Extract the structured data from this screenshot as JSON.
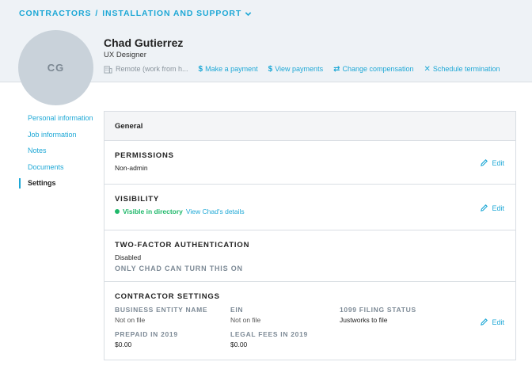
{
  "breadcrumb": {
    "section": "CONTRACTORS",
    "separator": "/",
    "team": "INSTALLATION AND SUPPORT"
  },
  "profile": {
    "initials": "CG",
    "name": "Chad Gutierrez",
    "role": "UX Designer",
    "location": "Remote (work from h..."
  },
  "actions": {
    "make_payment": "Make a payment",
    "view_payments": "View payments",
    "change_compensation": "Change compensation",
    "schedule_termination": "Schedule termination"
  },
  "sidebar": {
    "items": [
      {
        "label": "Personal information",
        "active": false
      },
      {
        "label": "Job information",
        "active": false
      },
      {
        "label": "Notes",
        "active": false
      },
      {
        "label": "Documents",
        "active": false
      },
      {
        "label": "Settings",
        "active": true
      }
    ]
  },
  "card": {
    "title": "General",
    "edit_label": "Edit",
    "permissions": {
      "title": "PERMISSIONS",
      "value": "Non-admin"
    },
    "visibility": {
      "title": "VISIBILITY",
      "status": "Visible in directory",
      "link": "View Chad's details"
    },
    "two_factor": {
      "title": "TWO-FACTOR AUTHENTICATION",
      "value": "Disabled",
      "note": "ONLY CHAD CAN TURN THIS ON"
    },
    "contractor_settings": {
      "title": "CONTRACTOR SETTINGS",
      "fields": [
        {
          "label": "BUSINESS ENTITY NAME",
          "value": "Not on file"
        },
        {
          "label": "EIN",
          "value": "Not on file"
        },
        {
          "label": "1099 FILING STATUS",
          "value": "Justworks to file"
        },
        {
          "label": "PREPAID IN 2019",
          "value": "$0.00"
        },
        {
          "label": "LEGAL FEES IN 2019",
          "value": "$0.00"
        }
      ]
    }
  },
  "colors": {
    "accent": "#1ea8d6",
    "success": "#1fb86a",
    "header_bg": "#eef2f6",
    "avatar_bg": "#c9d2da"
  }
}
